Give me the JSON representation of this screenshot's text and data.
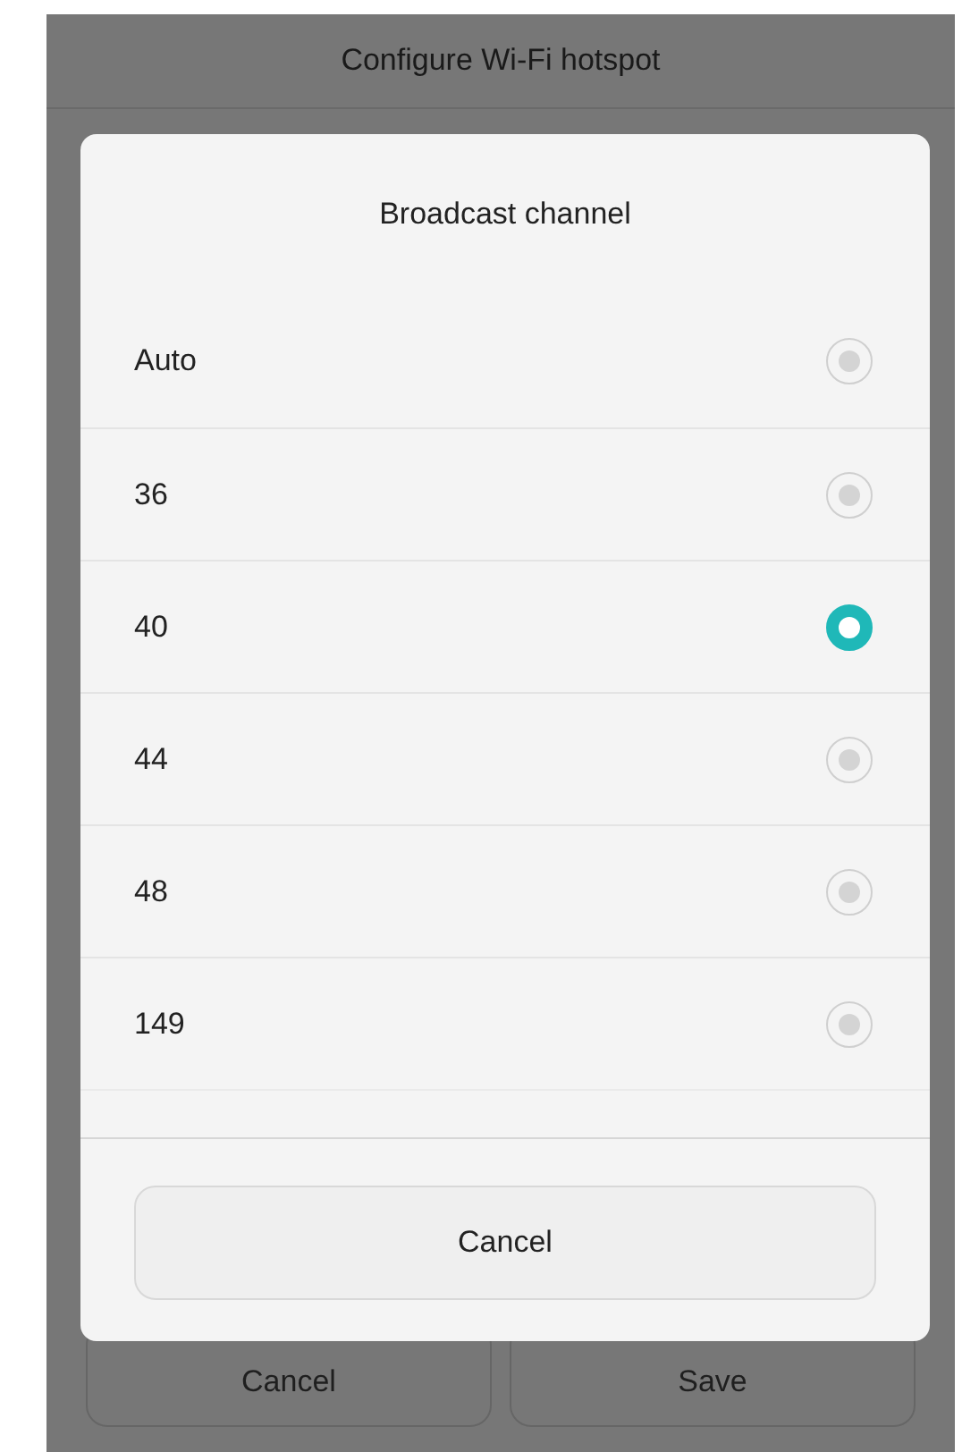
{
  "screen": {
    "title": "Configure Wi-Fi hotspot",
    "buttons": [
      "Cancel",
      "Save"
    ]
  },
  "dialog": {
    "title": "Broadcast channel",
    "options": [
      {
        "label": "Auto",
        "selected": false
      },
      {
        "label": "36",
        "selected": false
      },
      {
        "label": "40",
        "selected": true
      },
      {
        "label": "44",
        "selected": false
      },
      {
        "label": "48",
        "selected": false
      },
      {
        "label": "149",
        "selected": false
      }
    ],
    "cancel": "Cancel"
  }
}
